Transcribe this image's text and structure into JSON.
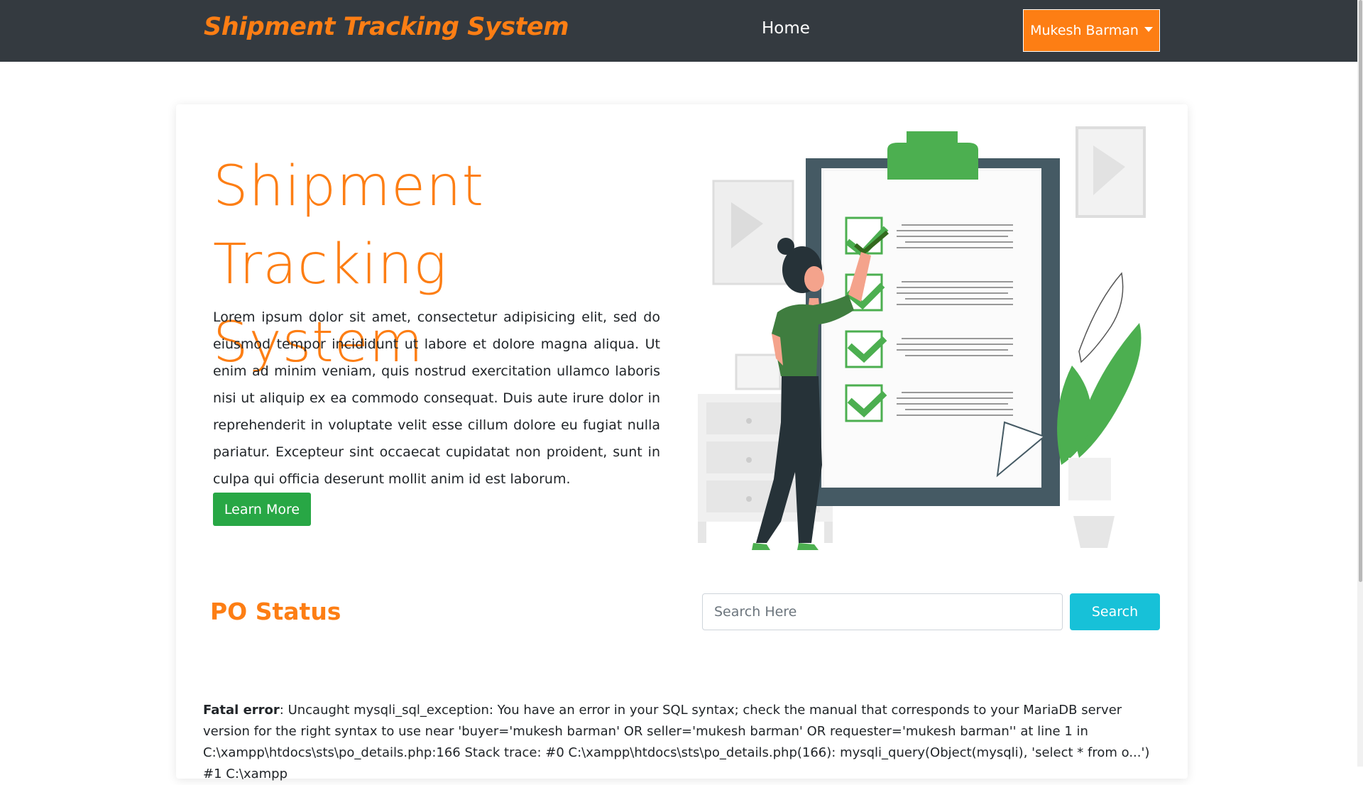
{
  "navbar": {
    "brand": "Shipment Tracking System",
    "home_label": "Home",
    "user_label": "Mukesh Barman",
    "background": "#343a40",
    "accent": "#fd7e14"
  },
  "hero": {
    "title_line1": "Shipment",
    "title_line2": "Tracking System",
    "body": "Lorem ipsum dolor sit amet, consectetur adipisicing elit, sed do eiusmod tempor incididunt ut labore et dolore magna aliqua. Ut enim ad minim veniam, quis nostrud exercitation ullamco laboris nisi ut aliquip ex ea commodo consequat. Duis aute irure dolor in reprehenderit in voluptate velit esse cillum dolore eu fugiat nulla pariatur. Excepteur sint occaecat cupidatat non proident, sunt in culpa qui officia deserunt mollit anim id est laborum.",
    "button_label": "Learn More",
    "button_color": "#28a745"
  },
  "illustration": {
    "icon": "checklist-clipboard-illustration",
    "accent": "#4caf50"
  },
  "po_status": {
    "title": "PO Status",
    "search_placeholder": "Search Here",
    "search_value": "",
    "search_button_label": "Search",
    "search_button_color": "#17c1d8"
  },
  "error": {
    "label": "Fatal error",
    "message": ": Uncaught mysqli_sql_exception: You have an error in your SQL syntax; check the manual that corresponds to your MariaDB server version for the right syntax to use near 'buyer='mukesh barman' OR seller='mukesh barman' OR requester='mukesh barman'' at line 1 in C:\\xampp\\htdocs\\sts\\po_details.php:166 Stack trace: #0 C:\\xampp\\htdocs\\sts\\po_details.php(166): mysqli_query(Object(mysqli), 'select * from o...') #1 C:\\xampp"
  }
}
